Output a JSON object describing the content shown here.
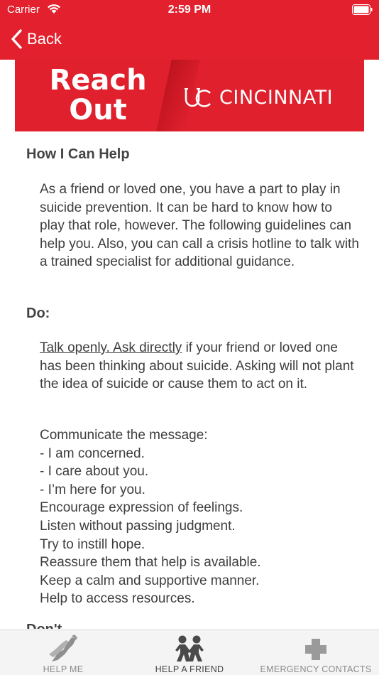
{
  "status": {
    "carrier": "Carrier",
    "time": "2:59 PM"
  },
  "nav": {
    "back_label": "Back"
  },
  "banner": {
    "line1": "Reach",
    "line2": "Out",
    "brand": "CINCINNATI"
  },
  "sections": {
    "help_heading": "How I Can Help",
    "help_text": "As a friend or loved one, you have a part to play in suicide prevention. It can be hard to know how to play that role, however. The following guidelines can help you. Also, you can call a crisis hotline to talk with a trained specialist for additional guidance.",
    "do_heading": "Do:",
    "do_link": "Talk openly. Ask directly",
    "do_text": " if your friend or loved one has been thinking about suicide. Asking will not plant the idea of suicide or cause them to act on it.",
    "list": [
      "Communicate the message:",
      "- I am concerned.",
      "- I care about you.",
      "- I’m here for you.",
      "Encourage expression of feelings.",
      "Listen without passing judgment.",
      "Try to instill hope.",
      "Reassure them that help is available.",
      "Keep a calm and supportive manner.",
      "Help to access resources."
    ],
    "next_heading_partial": "Don't"
  },
  "tabs": [
    {
      "label": "HELP ME",
      "icon": "helping-hands-icon",
      "active": false
    },
    {
      "label": "HELP A FRIEND",
      "icon": "two-people-icon",
      "active": true
    },
    {
      "label": "EMERGENCY CONTACTS",
      "icon": "medical-cross-icon",
      "active": false
    }
  ],
  "colors": {
    "brand_red": "#e3202d",
    "tab_bg": "#f4f4f4",
    "text": "#3d3d3d"
  }
}
